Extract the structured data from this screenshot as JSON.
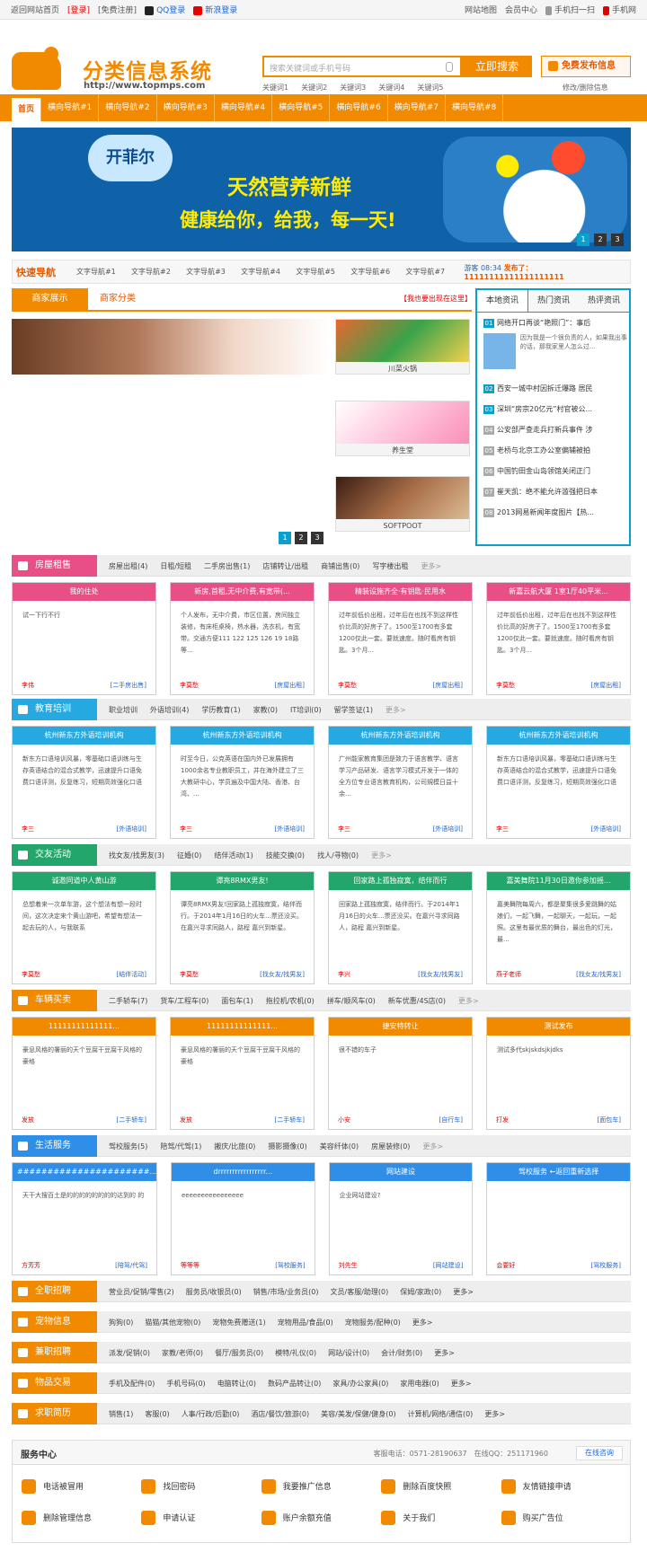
{
  "top": {
    "home": "返回网站首页",
    "login": "[登录]",
    "register": "[免费注册]",
    "qq": "QQ登录",
    "weibo": "新浪登录",
    "sitemap": "网站地图",
    "member": "会员中心",
    "mobile": "手机扫一扫",
    "mobile_site": "手机网"
  },
  "header": {
    "logo_title": "分类信息系统",
    "logo_url": "http://www.topmps.com",
    "search_placeholder": "搜索关键词或手机号码",
    "search_button": "立即搜索",
    "publish_button": "免费发布信息",
    "keywords": [
      "关键词1",
      "关键词2",
      "关键词3",
      "关键词4",
      "关键词5"
    ],
    "edit": "修改/删除信息"
  },
  "nav": [
    "首页",
    "横向导航#1",
    "横向导航#2",
    "横向导航#3",
    "横向导航#4",
    "横向导航#5",
    "横向导航#6",
    "横向导航#7",
    "横向导航#8"
  ],
  "banner": {
    "brand": "开菲尔",
    "line1": "天然营养新鲜",
    "line2": "健康给你，给我，每一天!",
    "pages": [
      "1",
      "2",
      "3"
    ]
  },
  "quick": {
    "title": "快速导航",
    "items": [
      "文字导航#1",
      "文字导航#2",
      "文字导航#3",
      "文字导航#4",
      "文字导航#5",
      "文字导航#6",
      "文字导航#7"
    ],
    "ticker_a": "游客 08:34",
    "ticker_b": "发布了：11111111111111111111"
  },
  "merchant": {
    "tab_a": "商家展示",
    "tab_b": "商家分类",
    "ad": "【我也要出现在这里】",
    "items": [
      "川菜火锅",
      "养生堂",
      "SOFTPOOT"
    ],
    "pages": [
      "1",
      "2",
      "3"
    ]
  },
  "news": {
    "tabs": [
      "本地资讯",
      "热门资讯",
      "热评资讯"
    ],
    "items": [
      "网络开口再谈“艳照门”：事后",
      "西安一城中村因拆迁爆路 居民",
      "深圳“房宗20亿元”村官被公...",
      "公安部严查走兵打新兵事件 涉",
      "老桥与北京工办公室偏辅被拍",
      "中国钓田金山岛领馆关闭正门",
      "崔天凯：绝不能允许滥强把日本",
      "2013网易新闻年度图片【热..."
    ],
    "feature": "因为我是一个很负责的人，如果我出事的话，那我家里人怎么过..."
  },
  "sections": [
    {
      "title": "房屋租售",
      "color": "#e94f87",
      "links": [
        "房屋出租(4)",
        "日租/短租",
        "二手房出售(1)",
        "店铺转让/出租",
        "商铺出售(0)",
        "写字楼出租"
      ],
      "more": "更多>"
    },
    {
      "title": "教育培训",
      "color": "#26a9e0",
      "links": [
        "职业培训",
        "外语培训(4)",
        "学历教育(1)",
        "家教(0)",
        "IT培训(0)",
        "留学签证(1)"
      ],
      "more": "更多>"
    },
    {
      "title": "交友活动",
      "color": "#23a66b",
      "links": [
        "找女友/找男友(3)",
        "征婚(0)",
        "结伴活动(1)",
        "技能交换(0)",
        "找人/寻物(0)"
      ],
      "more": "更多>"
    },
    {
      "title": "车辆买卖",
      "color": "#f28a00",
      "links": [
        "二手轿车(7)",
        "货车/工程车(0)",
        "面包车(1)",
        "拖拉机/农机(0)",
        "拼车/顺风车(0)",
        "新车优惠/4S店(0)"
      ],
      "more": "更多>"
    },
    {
      "title": "生活服务",
      "color": "#2f8ee8",
      "links": [
        "驾校服务(5)",
        "陪驾/代驾(1)",
        "搬庆/比旅(0)",
        "摄影摄像(0)",
        "美容纤体(0)",
        "房屋装修(0)"
      ],
      "more": "更多>"
    }
  ],
  "cards": [
    [
      {
        "title": "我的住处",
        "body": "试一下行不行",
        "user": "李伟",
        "cat": "[二手房出售]"
      },
      {
        "title": "新房,首租,无中介费,有宽带(...",
        "body": "个人发布，无中介费，市区位置，房间独立装修，有床柜桌椅，热水器，洗衣机，有宽带。交通方便111 122 125 126 19 18路等...",
        "user": "李莫愁",
        "cat": "[房屋出租]"
      },
      {
        "title": "精装设施齐全·有钥匙·民用水",
        "body": "过年前低价出租，过年后在也找不到这样性价比高的好房子了。1500至1700有多套1200仅此一套。要就速度。随时看房有钥匙。3个月...",
        "user": "李莫愁",
        "cat": "[房屋出租]"
      },
      {
        "title": "新嘉云航大厦 1室1厅40平米...",
        "body": "过年前低价出租，过年后在也找不到这样性价比高的好房子了。1500至1700有多套1200仅此一套。要就速度。随时看房有钥匙。3个月...",
        "user": "李莫愁",
        "cat": "[房屋出租]"
      }
    ],
    [
      {
        "title": "杭州新东方外语培训机构",
        "body": "新东方口语培训风暴，零基础口语训练与生存英语结合的混合式教学，迅速提升口语免费口语评测，反复练习，短期高效强化口语",
        "user": "李三",
        "cat": "[外语培训]"
      },
      {
        "title": "杭州新东方外语培训机构",
        "body": "时至今日，公克英语在国内外已发展拥有1000余名专业教职员工，并在海外建立了三大教研中心，学员遍及中国大陆、香港、台湾、...",
        "user": "李三",
        "cat": "[外语培训]"
      },
      {
        "title": "杭州新东方外语培训机构",
        "body": "广州能家教育集团是致力于语言教学、语言学习产品研发、语言学习模式开发于一体的全方位专业语言教育机构，公司規模日益十余...",
        "user": "李三",
        "cat": "[外语培训]"
      },
      {
        "title": "杭州新东方外语培训机构",
        "body": "新东方口语培训风暴，零基础口语训练与生存英语结合的混合式教学，迅速提升口语免费口语评测，反复练习，短期高效强化口语",
        "user": "李三",
        "cat": "[外语培训]"
      }
    ],
    [
      {
        "title": "诚邀同道中人黄山游",
        "body": "总想着来一次单车游，这个想法有想一段时间，这次决定来个黄山游吧，希望有想法一起去玩的人，与我联系",
        "user": "李莫愁",
        "cat": "[结伴活动]"
      },
      {
        "title": "谭亮8RMX男友!",
        "body": "谭亮8RMX男友!回家路上孤独寂寞，结伴而行。于2014年1月16日的火车...票还没买。在嘉兴寻求同路人，路程 嘉兴到新星。",
        "user": "李莫愁",
        "cat": "[找女友/找男友]"
      },
      {
        "title": "回家路上孤独寂寞，结伴而行",
        "body": "回家路上孤独寂寞，结伴而行。于2014年1月16日的火车...票还没买。在嘉兴寻求同路人，路程 嘉兴到新星。",
        "user": "李兴",
        "cat": "[找女友/找男友]"
      },
      {
        "title": "嘉美舞院11月30日邀你参加摇...",
        "body": "嘉美舞院每周六，都是聚集很多爱跳舞的姑娘们，一起飞舞，一起聊天，一起玩，一起照。这里有最优质的舞台，最出色的灯光，最...",
        "user": "燕子老师",
        "cat": "[找女友/找男友]"
      }
    ],
    [
      {
        "title": "11111111111111...",
        "body": "豪息风格的署丽的天个豆腐干豆腐干风格的豪格",
        "user": "发放",
        "cat": "[二手轿车]"
      },
      {
        "title": "11111111111111...",
        "body": "豪息风格的署丽的天个豆腐干豆腐干风格的豪格",
        "user": "发放",
        "cat": "[二手轿车]"
      },
      {
        "title": "捷安特转让",
        "body": "很不错的车子",
        "user": "小安",
        "cat": "[自行车]"
      },
      {
        "title": "测试发布",
        "body": "测试多代skjskdsjkjdks",
        "user": "打发",
        "cat": "[面包车]"
      }
    ],
    [
      {
        "title": "######################...",
        "body": "天干大搜百土是的的的的的的的的达到的 的",
        "user": "方芳芳",
        "cat": "[陪驾/代驾]"
      },
      {
        "title": "drrrrrrrrrrrrrrrrr...",
        "body": "eeeeeeeeeeeeeeee",
        "user": "等等等",
        "cat": "[驾校服务]"
      },
      {
        "title": "网站建设",
        "body": "企业网站建设?",
        "user": "刘先生",
        "cat": "[网站建设]"
      },
      {
        "title": "驾校服务 ←返回重新选择",
        "body": "",
        "user": "会要好",
        "cat": "[驾校服务]"
      }
    ]
  ],
  "small_sections": [
    {
      "title": "全职招聘",
      "links": [
        "营业员/促销/零售(2)",
        "服务员/收银员(0)",
        "销售/市场/业务员(0)",
        "文员/客服/助理(0)",
        "保姆/家政(0)"
      ],
      "more": "更多>"
    },
    {
      "title": "宠物信息",
      "links": [
        "狗狗(0)",
        "猫猫/其他宠物(0)",
        "宠物免费赠送(1)",
        "宠物用品/食品(0)",
        "宠物服务/配种(0)"
      ],
      "more": "更多>"
    },
    {
      "title": "兼职招聘",
      "links": [
        "派发/促销(0)",
        "家教/老师(0)",
        "餐厅/服务员(0)",
        "模特/礼仪(0)",
        "网站/设计(0)",
        "会计/财务(0)"
      ],
      "more": "更多>"
    },
    {
      "title": "物品交易",
      "links": [
        "手机及配件(0)",
        "手机号码(0)",
        "电脑转让(0)",
        "数码产品转让(0)",
        "家具/办公家具(0)",
        "家用电器(0)"
      ],
      "more": "更多>"
    },
    {
      "title": "求职简历",
      "links": [
        "销售(1)",
        "客服(0)",
        "人事/行政/后勤(0)",
        "酒店/餐饮/旅游(0)",
        "美容/美发/保健/健身(0)",
        "计算机/网络/通信(0)"
      ],
      "more": "更多>"
    }
  ],
  "service": {
    "title": "服务中心",
    "tel": "客服电话：0571-28190637　在线QQ：251171960",
    "online": "在线咨询",
    "items": [
      "电话被冒用",
      "找回密码",
      "我要推广信息",
      "删除百度快照",
      "友情链接申请",
      "删除管理信息",
      "申请认证",
      "账户余额充值",
      "关于我们",
      "购买广告位"
    ]
  }
}
